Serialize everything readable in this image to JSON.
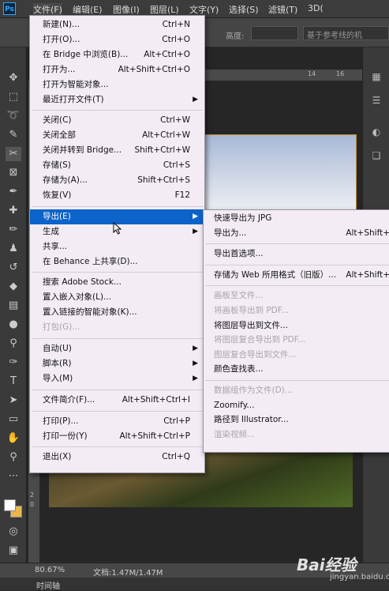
{
  "app": {
    "logo": "Ps"
  },
  "menubar": [
    "文件(F)",
    "编辑(E)",
    "图像(I)",
    "图层(L)",
    "文字(Y)",
    "选择(S)",
    "滤镜(T)",
    "3D("
  ],
  "options_bar": {
    "height_label": "高度:",
    "guide_text": "基于参考线的机"
  },
  "ruler": {
    "top_ticks": [
      "14",
      "16"
    ],
    "left_ticks": [
      "6",
      "2",
      "0"
    ]
  },
  "file_menu": {
    "groups": [
      [
        {
          "label": "新建(N)...",
          "shortcut": "Ctrl+N"
        },
        {
          "label": "打开(O)...",
          "shortcut": "Ctrl+O"
        },
        {
          "label": "在 Bridge 中浏览(B)...",
          "shortcut": "Alt+Ctrl+O"
        },
        {
          "label": "打开为...",
          "shortcut": "Alt+Shift+Ctrl+O"
        },
        {
          "label": "打开为智能对象..."
        },
        {
          "label": "最近打开文件(T)",
          "submenu": true
        }
      ],
      [
        {
          "label": "关闭(C)",
          "shortcut": "Ctrl+W"
        },
        {
          "label": "关闭全部",
          "shortcut": "Alt+Ctrl+W"
        },
        {
          "label": "关闭并转到 Bridge...",
          "shortcut": "Shift+Ctrl+W"
        },
        {
          "label": "存储(S)",
          "shortcut": "Ctrl+S"
        },
        {
          "label": "存储为(A)...",
          "shortcut": "Shift+Ctrl+S"
        },
        {
          "label": "恢复(V)",
          "shortcut": "F12"
        }
      ],
      [
        {
          "label": "导出(E)",
          "submenu": true,
          "highlight": true
        },
        {
          "label": "生成",
          "submenu": true
        },
        {
          "label": "共享..."
        },
        {
          "label": "在 Behance 上共享(D)..."
        }
      ],
      [
        {
          "label": "搜索 Adobe Stock..."
        },
        {
          "label": "置入嵌入对象(L)..."
        },
        {
          "label": "置入链接的智能对象(K)..."
        },
        {
          "label": "打包(G)...",
          "disabled": true
        }
      ],
      [
        {
          "label": "自动(U)",
          "submenu": true
        },
        {
          "label": "脚本(R)",
          "submenu": true
        },
        {
          "label": "导入(M)",
          "submenu": true
        }
      ],
      [
        {
          "label": "文件简介(F)...",
          "shortcut": "Alt+Shift+Ctrl+I"
        }
      ],
      [
        {
          "label": "打印(P)...",
          "shortcut": "Ctrl+P"
        },
        {
          "label": "打印一份(Y)",
          "shortcut": "Alt+Shift+Ctrl+P"
        }
      ],
      [
        {
          "label": "退出(X)",
          "shortcut": "Ctrl+Q"
        }
      ]
    ]
  },
  "export_menu": {
    "groups": [
      [
        {
          "label": "快速导出为 JPG"
        },
        {
          "label": "导出为...",
          "shortcut": "Alt+Shift+"
        }
      ],
      [
        {
          "label": "导出首选项..."
        }
      ],
      [
        {
          "label": "存储为 Web 所用格式（旧版）...",
          "shortcut": "Alt+Shift+"
        }
      ],
      [
        {
          "label": "画板至文件...",
          "disabled": true
        },
        {
          "label": "将画板导出到 PDF...",
          "disabled": true
        },
        {
          "label": "将图层导出到文件..."
        },
        {
          "label": "将图层复合导出到 PDF...",
          "disabled": true
        },
        {
          "label": "图层复合导出到文件...",
          "disabled": true
        },
        {
          "label": "颜色查找表..."
        }
      ],
      [
        {
          "label": "数据组作为文件(D)...",
          "disabled": true
        },
        {
          "label": "Zoomify..."
        },
        {
          "label": "路径到 Illustrator..."
        },
        {
          "label": "渲染视频...",
          "disabled": true
        }
      ]
    ]
  },
  "status": {
    "zoom": "80.67%",
    "doc": "文档:1.47M/1.47M"
  },
  "timeline_tab": "时间轴",
  "watermark": {
    "brand": "Bai经验",
    "url": "jingyan.baidu.com"
  },
  "colors": {
    "highlight": "#0c63c9",
    "menu_bg": "#f3ecf5",
    "ui_dark": "#3a3a3a"
  }
}
